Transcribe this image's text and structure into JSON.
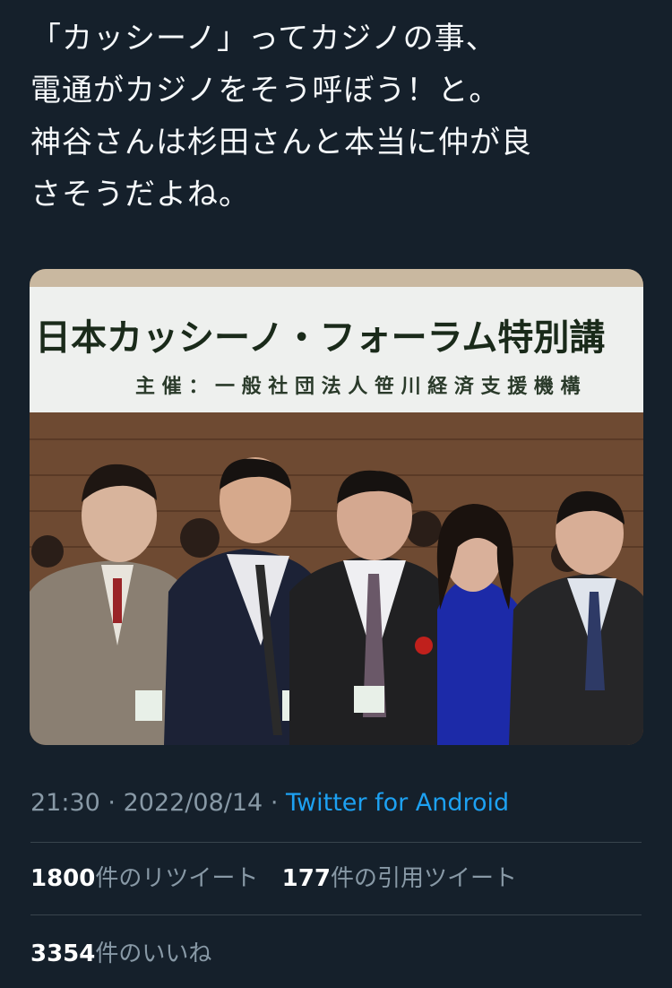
{
  "tweet": {
    "lines": [
      "「カッシーノ」ってカジノの事、",
      "電通がカジノをそう呼ぼう！と。",
      "神谷さんは杉田さんと本当に仲が良",
      "さそうだよね。"
    ]
  },
  "media": {
    "banner_title": "日本カッシーノ・フォーラム特別講",
    "banner_subtitle": "主 催 ： 一 般 社 団 法 人 笹 川 経 済 支 援 機 構"
  },
  "meta": {
    "time": "21:30",
    "separator": "·",
    "date": "2022/08/14",
    "source": "Twitter for Android"
  },
  "stats": {
    "retweets_count": "1800",
    "retweets_label": "件のリツイート",
    "quotes_count": "177",
    "quotes_label": "件の引用ツイート",
    "likes_count": "3354",
    "likes_label": "件のいいね"
  },
  "colors": {
    "background": "#15202b",
    "link": "#1da1f2",
    "secondary_text": "#8899a6"
  }
}
